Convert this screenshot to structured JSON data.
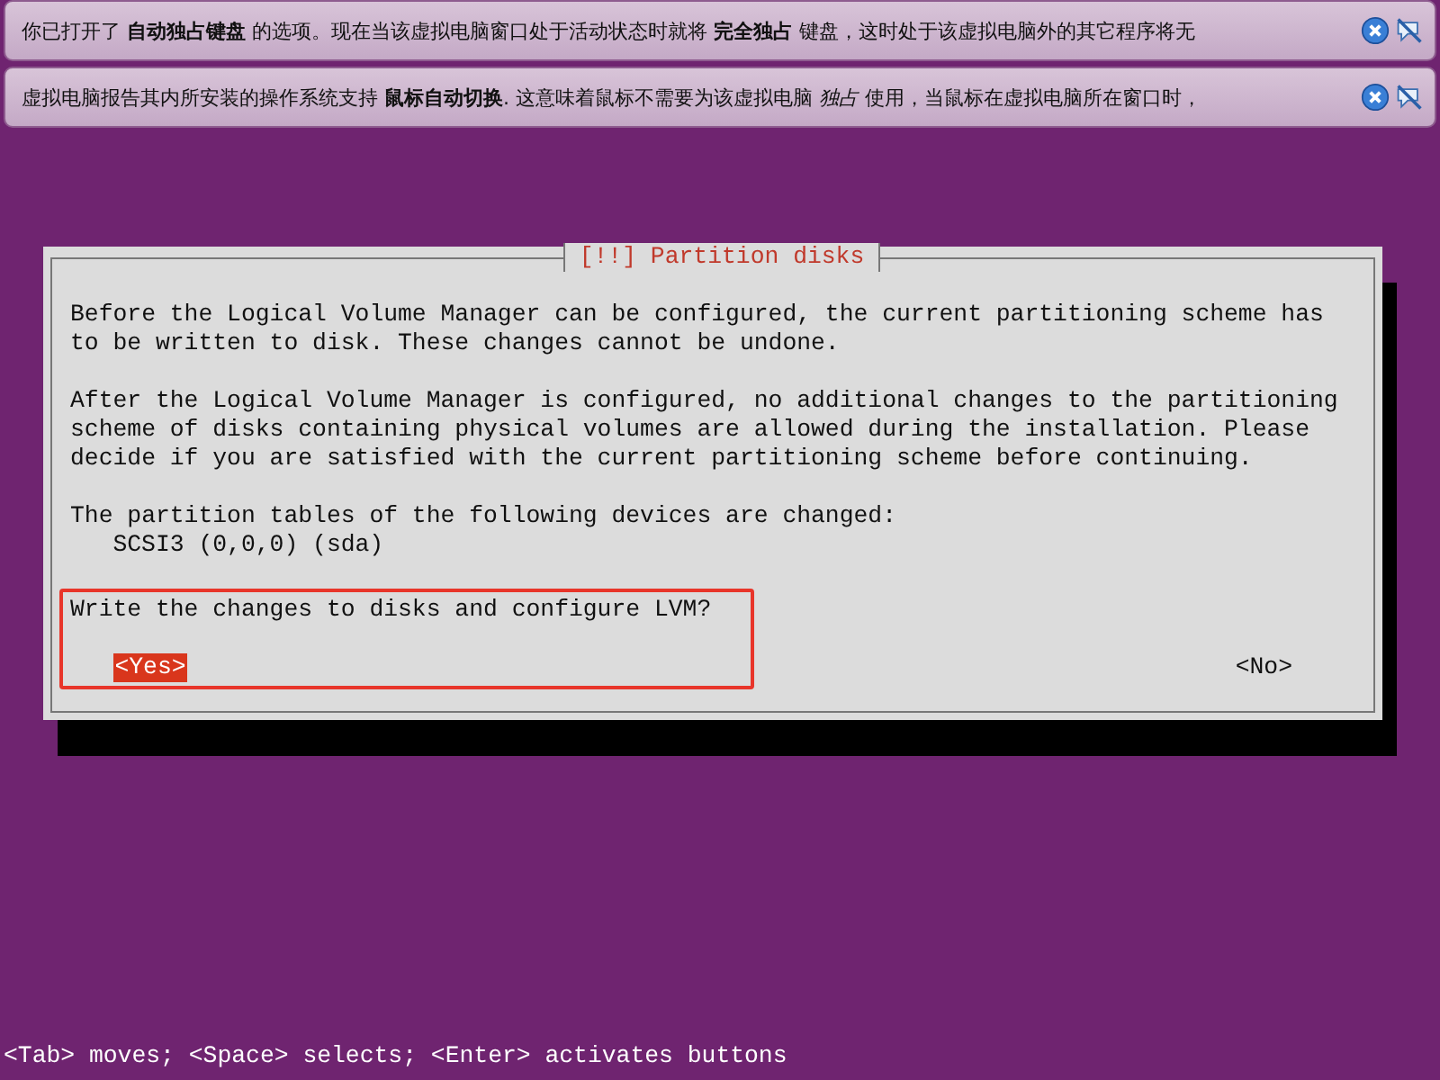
{
  "notifications": [
    {
      "text": "你已打开了 **自动独占键盘** 的选项。现在当该虚拟电脑窗口处于活动状态时就将 **完全独占** 键盘，这时处于该虚拟电脑外的其它程序将无"
    },
    {
      "text": "虚拟电脑报告其内所安装的操作系统支持 **鼠标自动切换**. 这意味着鼠标不需要为该虚拟电脑 *独占* 使用，当鼠标在虚拟电脑所在窗口时，"
    }
  ],
  "dialog": {
    "title": "[!!] Partition disks",
    "paragraphs": [
      "Before the Logical Volume Manager can be configured, the current partitioning scheme has to be written to disk. These changes cannot be undone.",
      "After the Logical Volume Manager is configured, no additional changes to the partitioning scheme of disks containing physical volumes are allowed during the installation. Please decide if you are satisfied with the current partitioning scheme before continuing."
    ],
    "devices_heading": "The partition tables of the following devices are changed:",
    "devices": [
      "SCSI3 (0,0,0) (sda)"
    ],
    "question": "Write the changes to disks and configure LVM?",
    "buttons": [
      {
        "label": "<Yes>",
        "selected": true
      },
      {
        "label": "<No>",
        "selected": false
      }
    ]
  },
  "status_bar": "<Tab> moves; <Space> selects; <Enter> activates buttons"
}
